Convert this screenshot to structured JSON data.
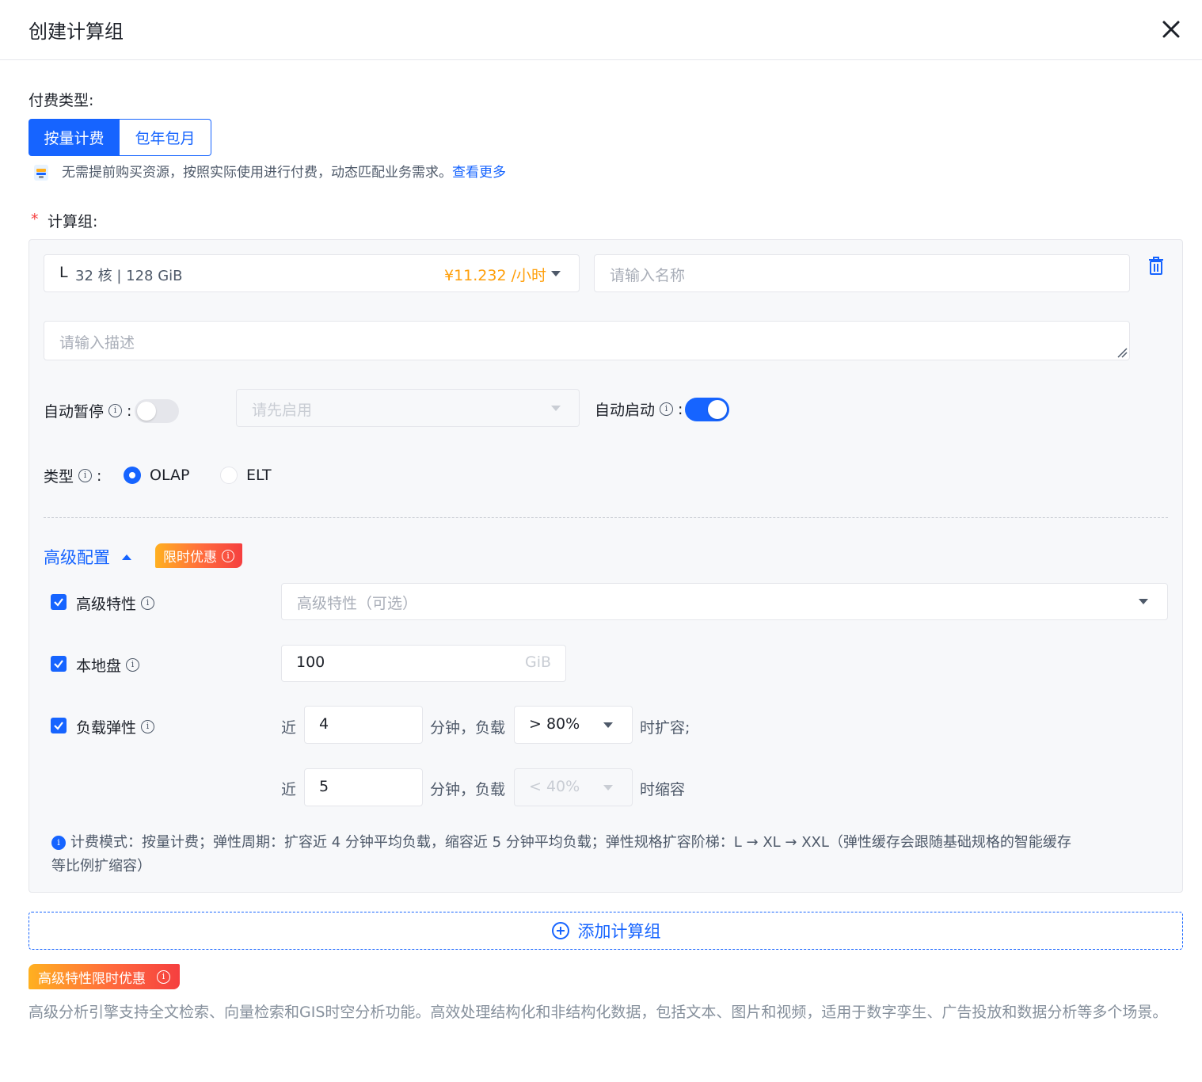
{
  "dialog": {
    "title": "创建计算组"
  },
  "billing": {
    "label": "付费类型:",
    "options": [
      "按量计费",
      "包年包月"
    ],
    "selected": "按量计费",
    "tip": "无需提前购买资源，按照实际使用进行付费，动态匹配业务需求。",
    "tip_link": "查看更多"
  },
  "compute_group": {
    "required_mark": "*",
    "label": "计算组:",
    "spec": {
      "size": "L",
      "detail": "32 核 | 128 GiB",
      "price": "¥11.232 /小时"
    },
    "name_placeholder": "请输入名称",
    "desc_placeholder": "请输入描述",
    "auto_pause": {
      "label": "自动暂停",
      "colon": ":",
      "enabled": false,
      "select_placeholder": "请先启用"
    },
    "auto_start": {
      "label": "自动启动",
      "colon": ":",
      "enabled": true
    },
    "type": {
      "label": "类型",
      "colon": ":",
      "options": [
        "OLAP",
        "ELT"
      ],
      "selected": "OLAP"
    },
    "advanced": {
      "label": "高级配置",
      "badge": "限时优惠",
      "features": {
        "label": "高级特性",
        "checked": true,
        "placeholder": "高级特性（可选）"
      },
      "local_disk": {
        "label": "本地盘",
        "checked": true,
        "value": "100",
        "unit": "GiB"
      },
      "elasticity": {
        "label": "负载弹性",
        "checked": true,
        "scale_out": {
          "prefix": "近",
          "minutes": "4",
          "mid": "分钟，负载",
          "threshold": "> 80%",
          "suffix": "时扩容;"
        },
        "scale_in": {
          "prefix": "近",
          "minutes": "5",
          "mid": "分钟，负载",
          "threshold": "< 40%",
          "suffix": "时缩容"
        }
      },
      "note_line1": "计费模式：按量计费；弹性周期：扩容近 4 分钟平均负载，缩容近 5 分钟平均负载；弹性规格扩容阶梯：L → XL → XXL（弹性缓存会跟随基础规格的智能缓存",
      "note_line2": "等比例扩缩容）"
    }
  },
  "add_button": "添加计算组",
  "promo": {
    "badge": "高级特性限时优惠",
    "text": "高级分析引擎支持全文检索、向量检索和GIS时空分析功能。高效处理结构化和非结构化数据，包括文本、图片和视频，适用于数字孪生、广告投放和数据分析等多个场景。"
  },
  "colors": {
    "primary": "#1664ff",
    "price": "#ff9f0a",
    "required": "#f53f3f"
  }
}
